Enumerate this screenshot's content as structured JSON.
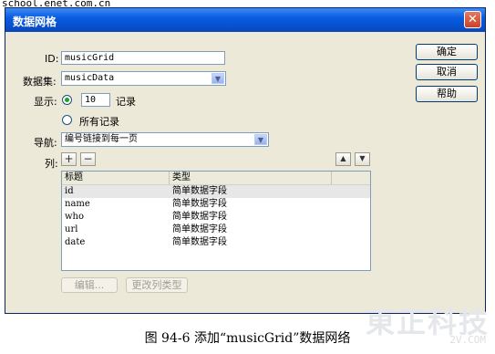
{
  "watermark_top": "school.enet.com.cn",
  "dialog": {
    "title": "数据网格",
    "close_glyph": "✕",
    "fields": {
      "id_label": "ID:",
      "id_value": "musicGrid",
      "dataset_label": "数据集:",
      "dataset_value": "musicData",
      "display_label": "显示:",
      "display_count": "10",
      "records_label": "记录",
      "all_records_label": "所有记录",
      "nav_label": "导航:",
      "nav_value": "编号链接到每一页",
      "columns_label": "列:"
    },
    "buttons": {
      "ok": "确定",
      "cancel": "取消",
      "help": "帮助",
      "add": "+",
      "remove": "−",
      "up": "▲",
      "down": "▼",
      "edit": "编辑...",
      "change_type": "更改列类型"
    },
    "grid": {
      "headers": [
        "标题",
        "类型"
      ],
      "rows": [
        [
          "id",
          "简单数据字段"
        ],
        [
          "name",
          "简单数据字段"
        ],
        [
          "who",
          "简单数据字段"
        ],
        [
          "url",
          "简单数据字段"
        ],
        [
          "date",
          "简单数据字段"
        ]
      ]
    }
  },
  "caption": "图 94-6    添加“musicGrid”数据网络",
  "watermark_logo": "東正科技",
  "watermark_url": "2V.COM"
}
